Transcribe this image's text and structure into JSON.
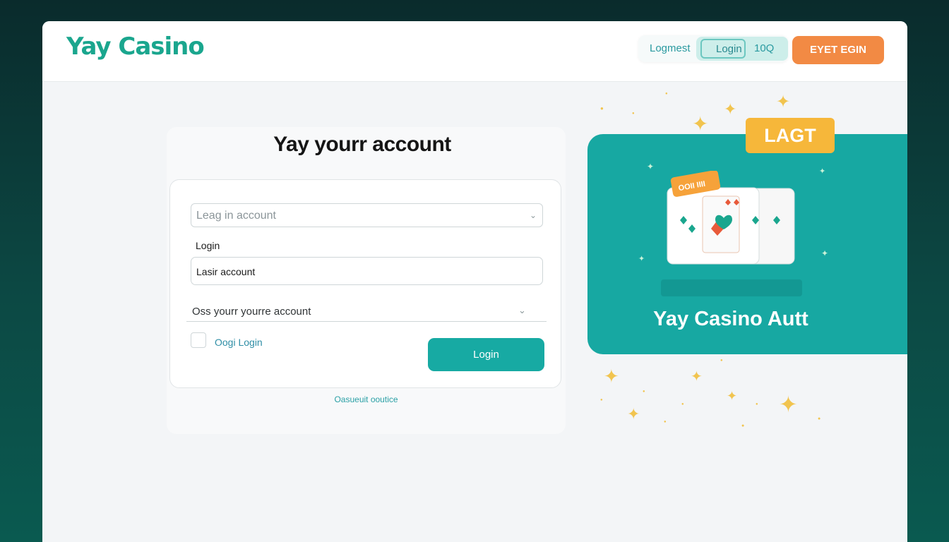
{
  "app": {
    "logo": "Yay Casino",
    "brand_color": "#1aa68e",
    "accent_color": "#17aaa3",
    "cta_color": "#f28a44"
  },
  "topbar": {
    "nav_link": "Logmest",
    "login_box": "Login",
    "count": "10Q",
    "cta_label": "EYET EGIN"
  },
  "form": {
    "heading": "Yay yourr account",
    "select_placeholder": "Leag in account",
    "login_label": "Login",
    "account_input_value": "Lasir account",
    "dropdown_text": "Oss yourr yourre account",
    "checkbox_label": "Oogi Login",
    "checkbox_checked": false,
    "submit_label": "Login",
    "footer_link": "Oasueuit ooutice"
  },
  "promo": {
    "badge": "LAGT",
    "card_tag": "OOII IIII",
    "title": "Yay Casino Autt"
  }
}
